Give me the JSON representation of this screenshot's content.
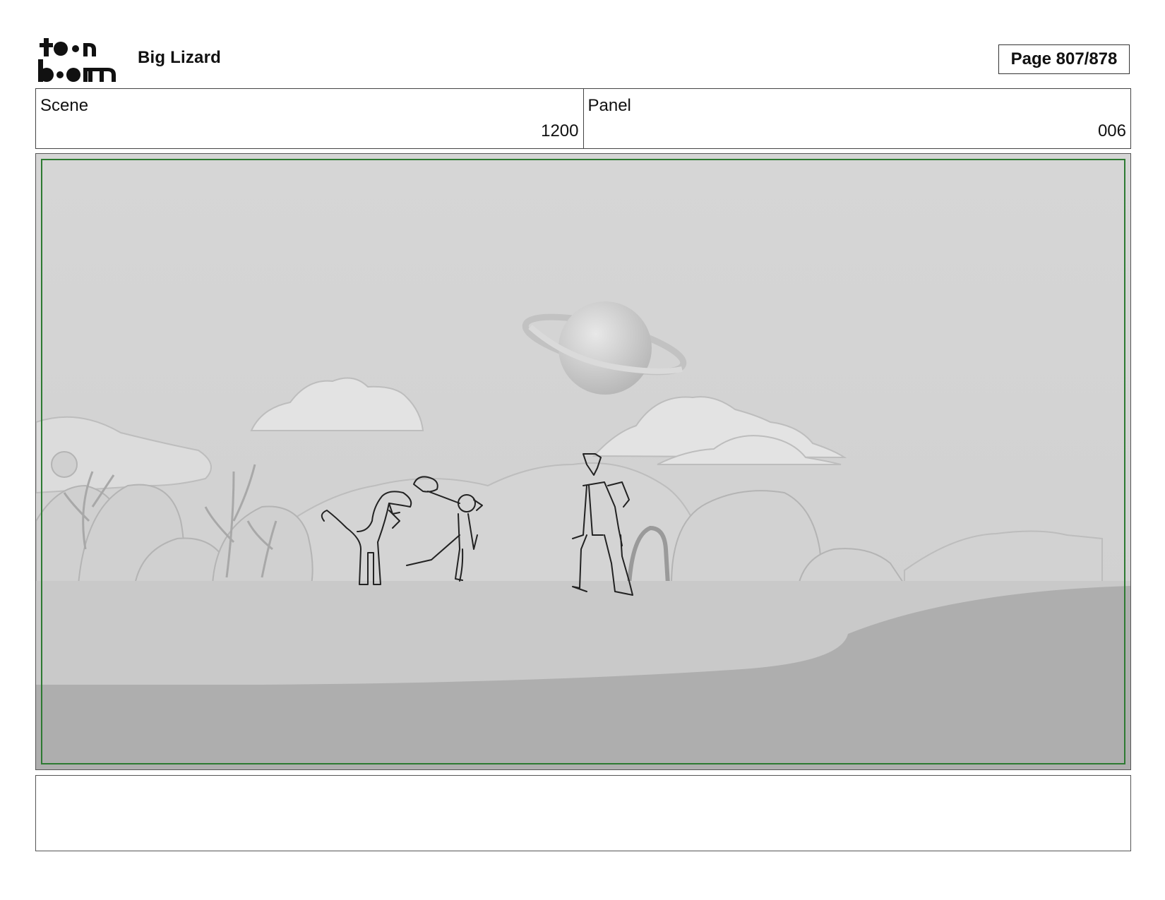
{
  "header": {
    "logo_icon": "toon-boom-logo",
    "project_title": "Big Lizard",
    "page_label": "Page 807/878"
  },
  "scene": {
    "label": "Scene",
    "value": "1200"
  },
  "panel": {
    "label": "Panel",
    "value": "006"
  },
  "frame": {
    "safe_border_color": "#2d7a32",
    "image": "storyboard-panel-drawing"
  },
  "notes": {
    "text": ""
  }
}
